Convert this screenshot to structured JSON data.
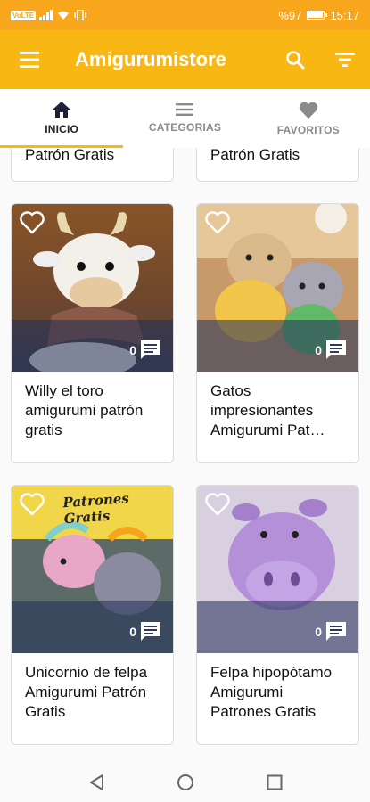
{
  "status_bar": {
    "sim_label": "VoLTE",
    "battery_text": "%97",
    "battery_level": 0.97,
    "time": "15:17"
  },
  "app_bar": {
    "title": "Amigurumistore",
    "icons": [
      "menu-icon",
      "search-icon",
      "filter-icon"
    ]
  },
  "tabs": [
    {
      "label": "INICIO",
      "icon": "home-icon",
      "active": true
    },
    {
      "label": "CATEGORIAS",
      "icon": "list-icon",
      "active": false
    },
    {
      "label": "FAVORITOS",
      "icon": "heart-icon",
      "active": false
    }
  ],
  "cards": [
    {
      "title": "Patrón Gratis",
      "comments": ""
    },
    {
      "title": "Patrón Gratis",
      "comments": ""
    },
    {
      "title": "Willy el toro amigurumi patrón gratis",
      "comments": "0"
    },
    {
      "title": "Gatos impresionantes Amigurumi Pat…",
      "comments": "0"
    },
    {
      "title": "Unicornio de felpa Amigurumi Patrón Gratis",
      "comments": "0"
    },
    {
      "title": "Felpa hipopótamo Amigurumi Patrones Gratis",
      "comments": "0",
      "image_text": "Patrones Gratis"
    }
  ],
  "card_images": {
    "3": {
      "watermark": "Patrones Gratis"
    }
  },
  "colors": {
    "status_bar": "#F8A61B",
    "app_bar": "#F9B713",
    "accent": "#F9B713"
  }
}
